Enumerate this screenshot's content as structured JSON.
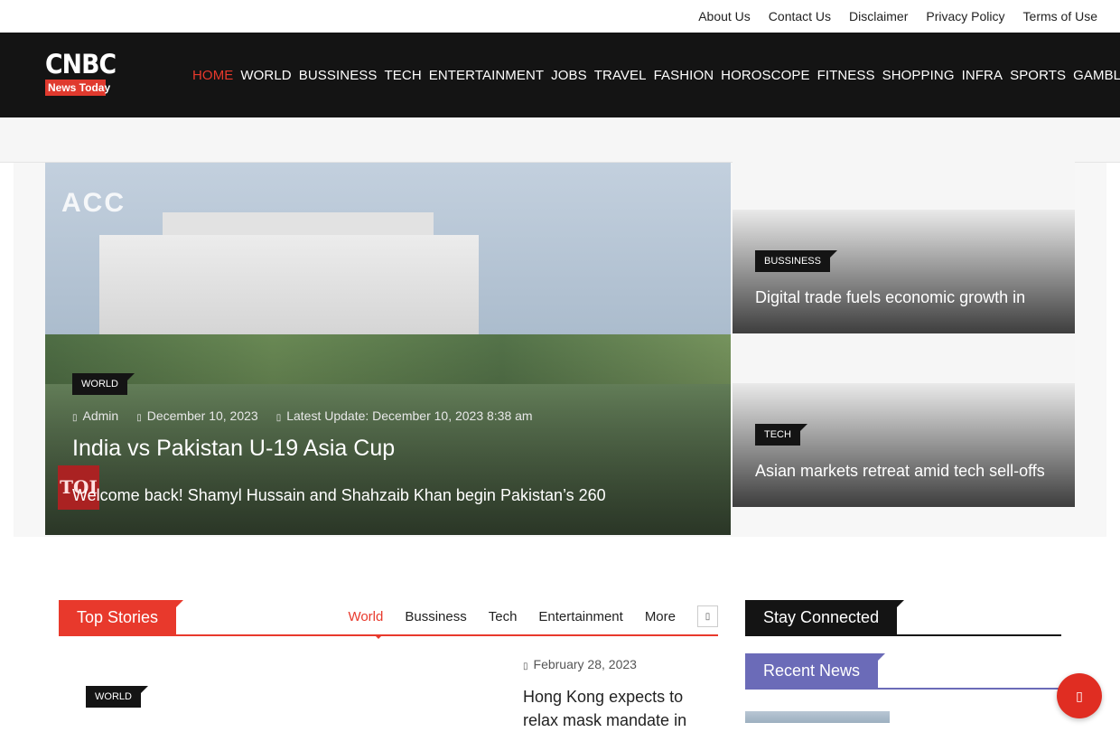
{
  "topbar": {
    "links": [
      "About Us",
      "Contact Us",
      "Disclaimer",
      "Privacy Policy",
      "Terms of Use"
    ]
  },
  "brand": {
    "name": "CNBC",
    "tagline": "News Today"
  },
  "nav": {
    "items": [
      "HOME",
      "WORLD",
      "BUSSINESS",
      "TECH",
      "ENTERTAINMENT",
      "JOBS",
      "TRAVEL",
      "FASHION",
      "HOROSCOPE",
      "FITNESS",
      "SHOPPING",
      "INFRA",
      "SPORTS",
      "GAMBLING"
    ],
    "active": "HOME"
  },
  "hero": {
    "image_text": "ACC",
    "watermark": "TOI",
    "category": "WORLD",
    "author": "Admin",
    "date": "December 10, 2023",
    "updated": "Latest Update: December 10, 2023 8:38 am",
    "title": "India vs Pakistan U-19 Asia Cup",
    "excerpt": "Welcome back! Shamyl Hussain and Shahzaib Khan begin Pakistan’s 260"
  },
  "side_cards": [
    {
      "category": "BUSSINESS",
      "title": "Digital trade fuels economic growth in"
    },
    {
      "category": "TECH",
      "title": "Asian markets retreat amid tech sell-offs"
    }
  ],
  "top_stories": {
    "heading": "Top Stories",
    "tabs": [
      "World",
      "Bussiness",
      "Tech",
      "Entertainment",
      "More"
    ],
    "selected_tab": "World",
    "article_category": "WORLD",
    "article_date": "February 28, 2023",
    "article_title": "Hong Kong expects to relax mask mandate in"
  },
  "sidebar": {
    "stay_connected": "Stay Connected",
    "recent_news": "Recent News"
  },
  "colors": {
    "accent": "#e8392c",
    "dark": "#141414",
    "recent": "#6b6bb8"
  }
}
